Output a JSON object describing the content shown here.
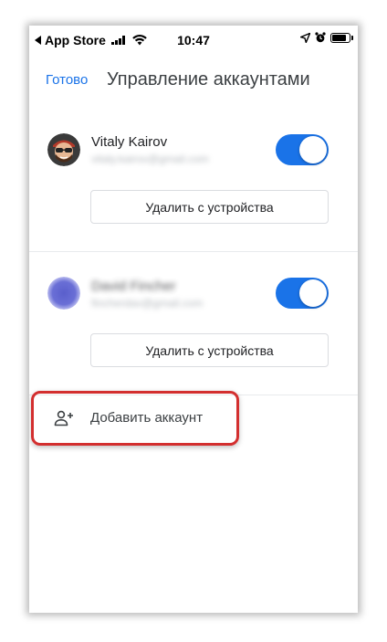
{
  "status_bar": {
    "carrier": "App Store",
    "time": "10:47"
  },
  "header": {
    "done_label": "Готово",
    "title": "Управление аккаунтами"
  },
  "accounts": [
    {
      "name": "Vitaly Kairov",
      "email": "vitaly.kairov@gmail.com",
      "sync_enabled": true,
      "remove_label": "Удалить с устройства"
    },
    {
      "name": "David Fincher",
      "email": "fincherdav@gmail.com",
      "sync_enabled": true,
      "remove_label": "Удалить с устройства"
    }
  ],
  "add_account": {
    "label": "Добавить аккаунт"
  },
  "colors": {
    "accent": "#1a73e8",
    "highlight": "#d32f2f",
    "avatar_2": "#6a6fd6"
  },
  "icons": {
    "back": "back-triangle-icon",
    "signal": "cellular-signal-icon",
    "wifi": "wifi-icon",
    "location": "location-arrow-icon",
    "alarm": "alarm-clock-icon",
    "battery": "battery-icon",
    "add_account": "person-add-icon"
  }
}
